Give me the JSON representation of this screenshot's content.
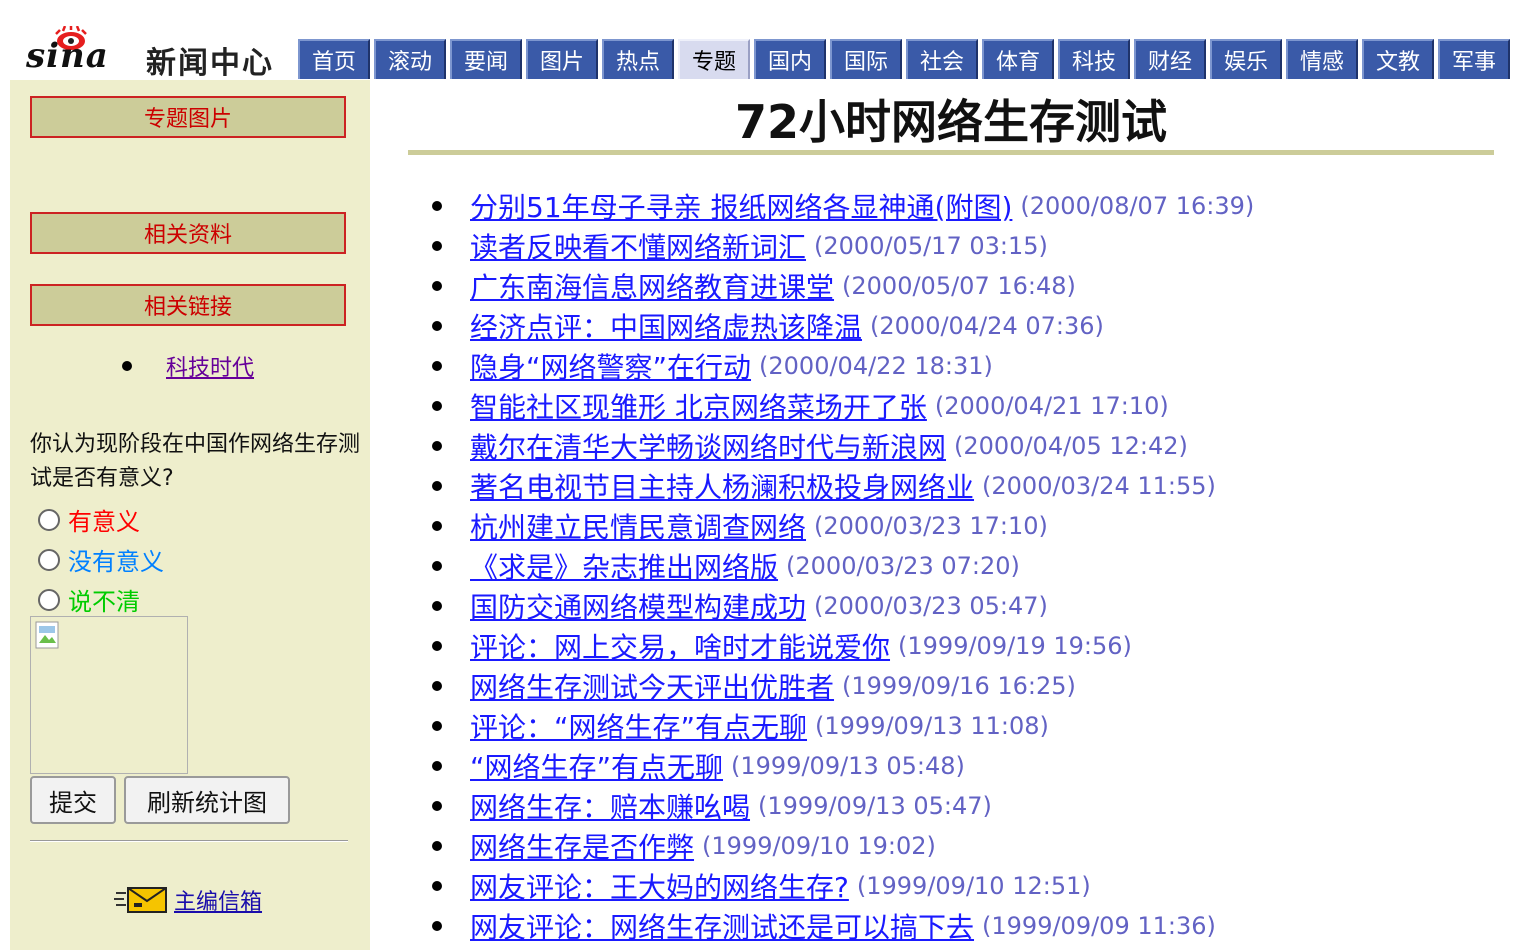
{
  "header": {
    "logo_text": "sina",
    "site_name": "新闻中心",
    "nav": [
      "首页",
      "滚动",
      "要闻",
      "图片",
      "热点",
      "专题",
      "国内",
      "国际",
      "社会",
      "体育",
      "科技",
      "财经",
      "娱乐",
      "情感",
      "文教",
      "军事"
    ],
    "active_tab": "专题"
  },
  "sidebar": {
    "buttons": [
      "专题图片",
      "相关资料",
      "相关链接"
    ],
    "related_link": "科技时代",
    "poll": {
      "question": "你认为现阶段在中国作网络生存测试是否有意义?",
      "options": [
        {
          "label": "有意义",
          "color": "#ff0000"
        },
        {
          "label": "没有意义",
          "color": "#0080ff"
        },
        {
          "label": "说不清",
          "color": "#00cc00"
        }
      ],
      "submit_label": "提交",
      "refresh_label": "刷新统计图"
    },
    "mail_label": "主编信箱"
  },
  "main": {
    "title": "72小时网络生存测试",
    "articles": [
      {
        "title": "分别51年母子寻亲 报纸网络各显神通(附图)",
        "date": "(2000/08/07 16:39)"
      },
      {
        "title": "读者反映看不懂网络新词汇",
        "date": "(2000/05/17 03:15)"
      },
      {
        "title": "广东南海信息网络教育进课堂",
        "date": "(2000/05/07 16:48)"
      },
      {
        "title": "经济点评：中国网络虚热该降温",
        "date": "(2000/04/24 07:36)"
      },
      {
        "title": "隐身“网络警察”在行动",
        "date": "(2000/04/22 18:31)"
      },
      {
        "title": "智能社区现雏形 北京网络菜场开了张",
        "date": "(2000/04/21 17:10)"
      },
      {
        "title": "戴尔在清华大学畅谈网络时代与新浪网",
        "date": "(2000/04/05 12:42)"
      },
      {
        "title": "著名电视节目主持人杨澜积极投身网络业",
        "date": "(2000/03/24 11:55)"
      },
      {
        "title": "杭州建立民情民意调查网络",
        "date": "(2000/03/23 17:10)"
      },
      {
        "title": "《求是》杂志推出网络版",
        "date": "(2000/03/23 07:20)"
      },
      {
        "title": "国防交通网络模型构建成功",
        "date": "(2000/03/23 05:47)"
      },
      {
        "title": "评论：网上交易，啥时才能说爱你",
        "date": "(1999/09/19 19:56)"
      },
      {
        "title": "网络生存测试今天评出优胜者",
        "date": "(1999/09/16 16:25)"
      },
      {
        "title": "评论：“网络生存”有点无聊",
        "date": "(1999/09/13 11:08)"
      },
      {
        "title": "“网络生存”有点无聊",
        "date": "(1999/09/13 05:48)"
      },
      {
        "title": "网络生存：赔本赚吆喝",
        "date": "(1999/09/13 05:47)"
      },
      {
        "title": "网络生存是否作弊",
        "date": "(1999/09/10 19:02)"
      },
      {
        "title": "网友评论：王大妈的网络生存?",
        "date": "(1999/09/10 12:51)"
      },
      {
        "title": "网友评论：网络生存测试还是可以搞下去",
        "date": "(1999/09/09 11:36)"
      }
    ]
  }
}
